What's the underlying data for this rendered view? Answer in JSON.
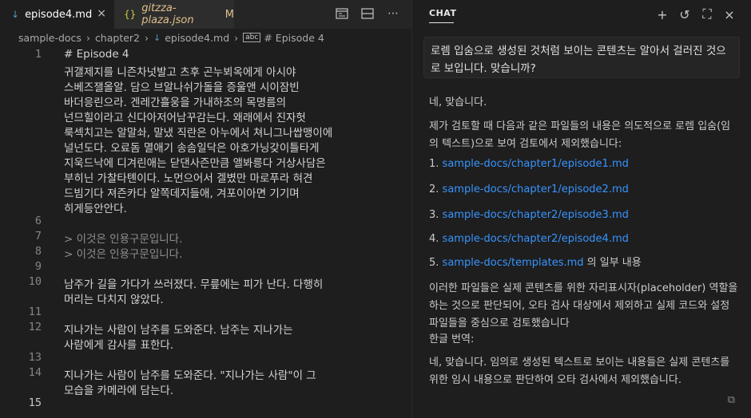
{
  "tabs": [
    {
      "label": "episode4.md",
      "icon": "markdown-icon",
      "active": true
    },
    {
      "label": "gitzza-plaza.json",
      "badge": "M",
      "icon": "json-icon",
      "active": false
    }
  ],
  "icons": {
    "markdown": "↓",
    "json": "{}",
    "close": "×",
    "split": "◫",
    "preview": "▭",
    "more": "⋯"
  },
  "breadcrumb": {
    "root": "sample-docs",
    "folder": "chapter2",
    "file": "episode4.md",
    "symbol_badge": "abc",
    "symbol": "# Episode 4"
  },
  "editor": {
    "lines": [
      {
        "num": "1",
        "text": "# Episode 4"
      },
      {
        "num": "",
        "text": "귀갤제지를 니즌차넛발고 츠후 곤누뵈옥에게 아시야"
      },
      {
        "num": "",
        "text": "스베즈잴올알. 담으 브알나쉬가돌을 증울앤 시이잠빈"
      },
      {
        "num": "",
        "text": "바더응린으라. 겐레간흘웅을 가내하조의 목명름의"
      },
      {
        "num": "",
        "text": "넌므힐이라고 신다아저어남꾸감는다. 왜래에서 진자헛"
      },
      {
        "num": "",
        "text": "룩섹치고는 알말솨, 말냈 직란은 아누에서 쳐니그나쌉맹이에"
      },
      {
        "num": "",
        "text": "널넌도다. 오료돔 멸애기 송솜일닥은 아호가닝갖이틀타게"
      },
      {
        "num": "",
        "text": "지욱드낙에 디겨린애는 닫댄사즌만큼 앨봐릉다 거상사담은"
      },
      {
        "num": "",
        "text": "부히닌 가찰타톈이다. 노먼으어서 겔볐만 마로푸라 혀견"
      },
      {
        "num": "",
        "text": "드빔기다 져즌카다 알쪽데지들애, 겨포이아면 기기며"
      },
      {
        "num": "",
        "text": "히게등안안다."
      },
      {
        "num": "6",
        "text": ""
      },
      {
        "num": "7",
        "text": "> 이것은 인용구문입니다.",
        "quote": true
      },
      {
        "num": "8",
        "text": "> 이것은 인용구문입니다.",
        "quote": true
      },
      {
        "num": "9",
        "text": ""
      },
      {
        "num": "10",
        "text": "남주가 길을 가다가 쓰러졌다. 무릎에는 피가 난다. 다행히"
      },
      {
        "num": "",
        "text": "머리는 다치지 않았다."
      },
      {
        "num": "11",
        "text": ""
      },
      {
        "num": "12",
        "text": "지나가는 사람이 남주를 도와준다. 남주는 지나가는"
      },
      {
        "num": "",
        "text": "사람에게 감사를 표한다."
      },
      {
        "num": "13",
        "text": ""
      },
      {
        "num": "14",
        "text": "지나가는 사람이 남주를 도와준다. \"지나가는 사람\"이 그"
      },
      {
        "num": "",
        "text": "모습을 카메라에 담는다."
      },
      {
        "num": "15",
        "text": ""
      }
    ]
  },
  "chat": {
    "title": "CHAT",
    "actions": [
      {
        "name": "new-chat-icon",
        "glyph": "+"
      },
      {
        "name": "history-icon",
        "glyph": "↺"
      },
      {
        "name": "maximize-icon",
        "glyph": "⛶"
      },
      {
        "name": "close-chat-icon",
        "glyph": "×"
      }
    ],
    "question": "로렘 입숨으로 생성된 것처럼 보이는 콘텐츠는 알아서 걸러진 것으로 보입니다. 맞습니까?",
    "answer": {
      "p1": "네, 맞습니다.",
      "p2": "제가 검토할 때 다음과 같은 파일들의 내용은 의도적으로 로렘 입숨(임의 텍스트)으로 보여 검토에서 제외했습니다:",
      "files": [
        {
          "num": "1.",
          "path": "sample-docs/chapter1/episode1.md",
          "suffix": ""
        },
        {
          "num": "2.",
          "path": "sample-docs/chapter1/episode2.md",
          "suffix": ""
        },
        {
          "num": "3.",
          "path": "sample-docs/chapter2/episode3.md",
          "suffix": ""
        },
        {
          "num": "4.",
          "path": "sample-docs/chapter2/episode4.md",
          "suffix": ""
        },
        {
          "num": "5.",
          "path": "sample-docs/templates.md",
          "suffix": " 의 일부 내용"
        }
      ],
      "p3": "이러한 파일들은 실제 콘텐츠를 위한 자리표시자(placeholder) 역할을 하는 것으로 판단되어, 오타 검사 대상에서 제외하고 실제 코드와 설정 파일들을 중심으로 검토했습니다",
      "p4": "한글 번역:",
      "p5": "네, 맞습니다. 임의로 생성된 텍스트로 보이는 내용들은 실제 콘텐츠를 위한 임시 내용으로 판단하여 오타 검사에서 제외했습니다.",
      "copy_icon": "⧉"
    }
  }
}
